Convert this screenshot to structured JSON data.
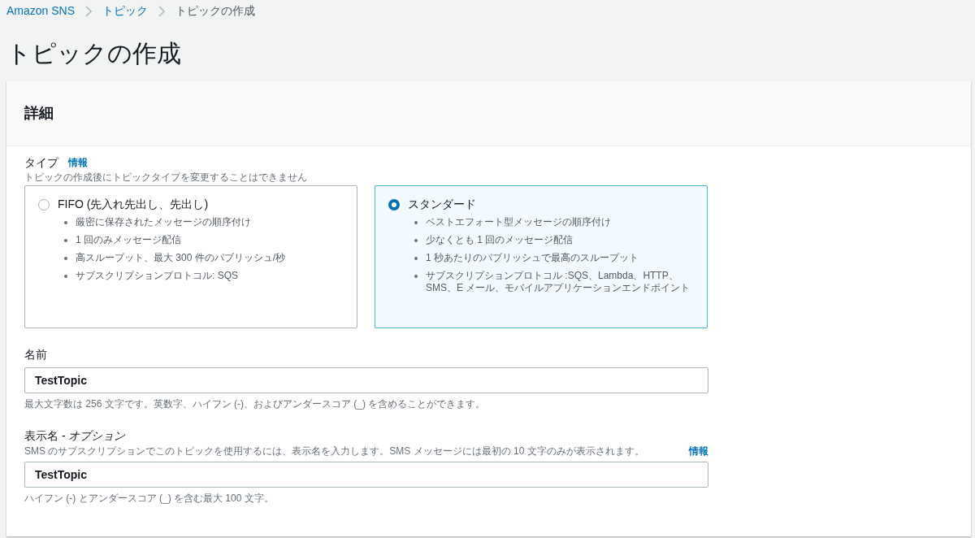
{
  "breadcrumbs": [
    {
      "label": "Amazon SNS",
      "kind": "link"
    },
    {
      "label": "トピック",
      "kind": "link"
    },
    {
      "label": "トピックの作成",
      "kind": "current"
    }
  ],
  "page_title": "トピックの作成",
  "panel": {
    "title": "詳細",
    "type_field": {
      "label": "タイプ",
      "info": "情報",
      "description": "トピックの作成後にトピックタイプを変更することはできません",
      "options": [
        {
          "label": "FIFO (先入れ先出し、先出し)",
          "selected": false,
          "bullets": [
            "厳密に保存されたメッセージの順序付け",
            "1 回のみメッセージ配信",
            "高スループット、最大 300 件のパブリッシュ/秒",
            "サブスクリプションプロトコル: SQS"
          ]
        },
        {
          "label": "スタンダード",
          "selected": true,
          "bullets": [
            "ベストエフォート型メッセージの順序付け",
            "少なくとも 1 回のメッセージ配信",
            "1 秒あたりのパブリッシュで最高のスループット",
            "サブスクリプションプロトコル :SQS、Lambda、HTTP、SMS、E メール、モバイルアプリケーションエンドポイント"
          ]
        }
      ]
    },
    "name_field": {
      "label": "名前",
      "value": "TestTopic",
      "hint": "最大文字数は 256 文字です。英数字、ハイフン (-)、およびアンダースコア (_) を含めることができます。"
    },
    "display_name_field": {
      "label": "表示名 - *オプション*",
      "description": "SMS のサブスクリプションでこのトピックを使用するには、表示名を入力します。SMS メッセージには最初の 10 文字のみが表示されます。",
      "info": "情報",
      "value": "TestTopic",
      "hint": "ハイフン (-) とアンダースコア (_) を含む最大 100 文字。"
    }
  }
}
